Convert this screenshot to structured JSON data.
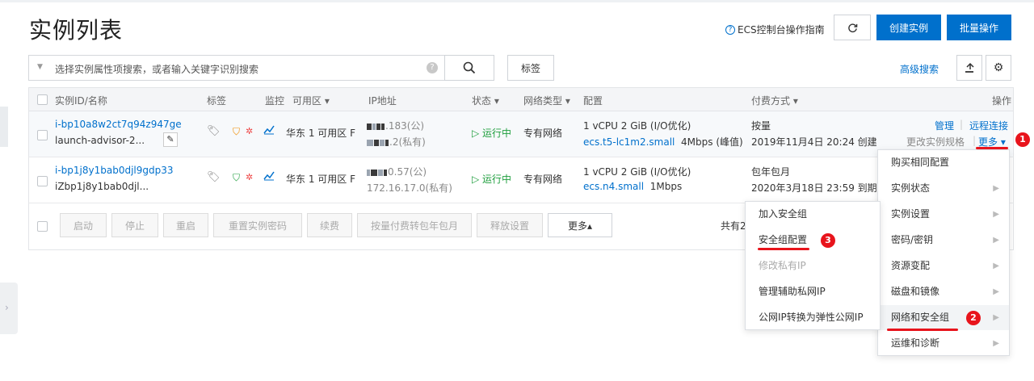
{
  "page": {
    "title": "实例列表",
    "guide_link": "ECS控制台操作指南",
    "create_button": "创建实例",
    "batch_button": "批量操作"
  },
  "search": {
    "placeholder": "选择实例属性项搜索，或者输入关键字识别搜索",
    "tag_button": "标签",
    "advanced": "高级搜索"
  },
  "columns": {
    "id": "实例ID/名称",
    "tags": "标签",
    "monitor": "监控",
    "zone": "可用区",
    "ip": "IP地址",
    "status": "状态",
    "network": "网络类型",
    "config": "配置",
    "billing": "付费方式",
    "actions": "操作"
  },
  "instances": [
    {
      "id": "i-bp10a8w2ct7q94z947ge",
      "name": "launch-advisor-2...",
      "zone": "华东 1 可用区 F",
      "ip_public": ".183(公)",
      "ip_private": ".2(私有)",
      "status": "运行中",
      "network": "专有网络",
      "config_line1": "1 vCPU 2 GiB (I/O优化)",
      "config_type": "ecs.t5-lc1m2.small",
      "config_bw": "4Mbps (峰值)",
      "billing_type": "按量",
      "billing_date": "2019年11月4日 20:24 创建",
      "action_manage": "管理",
      "action_remote": "远程连接",
      "action_change": "更改实例规格",
      "action_more": "更多"
    },
    {
      "id": "i-bp1j8y1bab0djl9gdp33",
      "name": "iZbp1j8y1bab0djl...",
      "zone": "华东 1 可用区 F",
      "ip_public": "0.57(公)",
      "ip_private": "172.16.17.0(私有)",
      "status": "运行中",
      "network": "专有网络",
      "config_line1": "1 vCPU 2 GiB (I/O优化)",
      "config_type": "ecs.n4.small",
      "config_bw": "1Mbps",
      "billing_type": "包年包月",
      "billing_date": "2020年3月18日 23:59 到期"
    }
  ],
  "bulk": {
    "start": "启动",
    "stop": "停止",
    "restart": "重启",
    "reset_pwd": "重置实例密码",
    "renew": "续费",
    "convert": "按量付费转包年包月",
    "release": "释放设置",
    "more": "更多▴",
    "total_prefix": "共有2"
  },
  "main_menu": [
    "购买相同配置",
    "实例状态",
    "实例设置",
    "密码/密钥",
    "资源变配",
    "磁盘和镜像",
    "网络和安全组",
    "运维和诊断"
  ],
  "sub_menu": [
    "加入安全组",
    "安全组配置",
    "修改私有IP",
    "管理辅助私网IP",
    "公网IP转换为弹性公网IP"
  ],
  "badges": [
    "1",
    "2",
    "3"
  ],
  "colors": {
    "accent": "#0070cc",
    "highlight": "#e8141c",
    "running": "#1e9e3d"
  }
}
